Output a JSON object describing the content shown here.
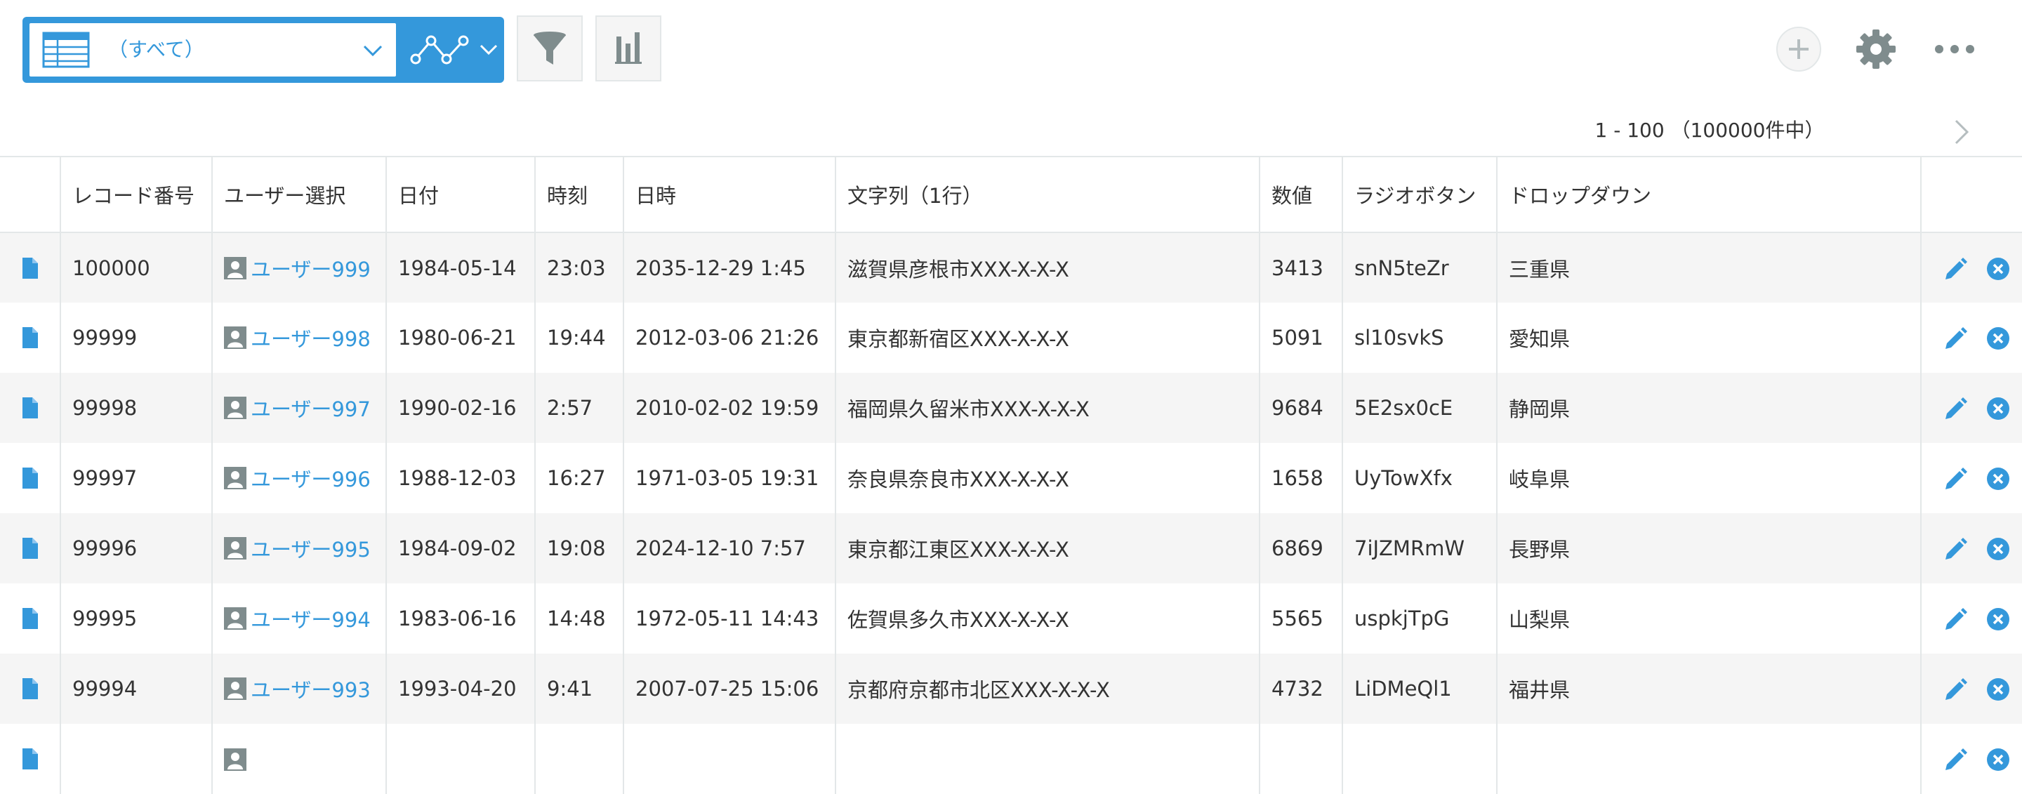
{
  "toolbar": {
    "view_label": "（すべて）",
    "icons": [
      "table-icon",
      "chevron-down-icon",
      "graph-icon",
      "filter-icon",
      "bar-chart-icon",
      "add-icon",
      "gear-icon",
      "more-icon"
    ]
  },
  "pager": {
    "range": "1 - 100 （100000件中）",
    "next_icon": "chevron-right-icon"
  },
  "table": {
    "headers": [
      "レコード番号",
      "ユーザー選択",
      "日付",
      "時刻",
      "日時",
      "文字列（1行）",
      "数値",
      "ラジオボタン",
      "ドロップダウン"
    ],
    "rows": [
      {
        "record_no": "100000",
        "user": "ユーザー999",
        "date": "1984-05-14",
        "time": "23:03",
        "datetime": "2035-12-29 1:45",
        "text": "滋賀県彦根市XXX-X-X-X",
        "number": "3413",
        "radio": "snN5teZr",
        "dropdown": "三重県"
      },
      {
        "record_no": "99999",
        "user": "ユーザー998",
        "date": "1980-06-21",
        "time": "19:44",
        "datetime": "2012-03-06 21:26",
        "text": "東京都新宿区XXX-X-X-X",
        "number": "5091",
        "radio": "sl10svkS",
        "dropdown": "愛知県"
      },
      {
        "record_no": "99998",
        "user": "ユーザー997",
        "date": "1990-02-16",
        "time": "2:57",
        "datetime": "2010-02-02 19:59",
        "text": "福岡県久留米市XXX-X-X-X",
        "number": "9684",
        "radio": "5E2sx0cE",
        "dropdown": "静岡県"
      },
      {
        "record_no": "99997",
        "user": "ユーザー996",
        "date": "1988-12-03",
        "time": "16:27",
        "datetime": "1971-03-05 19:31",
        "text": "奈良県奈良市XXX-X-X-X",
        "number": "1658",
        "radio": "UyTowXfx",
        "dropdown": "岐阜県"
      },
      {
        "record_no": "99996",
        "user": "ユーザー995",
        "date": "1984-09-02",
        "time": "19:08",
        "datetime": "2024-12-10 7:57",
        "text": "東京都江東区XXX-X-X-X",
        "number": "6869",
        "radio": "7iJZMRmW",
        "dropdown": "長野県"
      },
      {
        "record_no": "99995",
        "user": "ユーザー994",
        "date": "1983-06-16",
        "time": "14:48",
        "datetime": "1972-05-11 14:43",
        "text": "佐賀県多久市XXX-X-X-X",
        "number": "5565",
        "radio": "uspkjTpG",
        "dropdown": "山梨県"
      },
      {
        "record_no": "99994",
        "user": "ユーザー993",
        "date": "1993-04-20",
        "time": "9:41",
        "datetime": "2007-07-25 15:06",
        "text": "京都府京都市北区XXX-X-X-X",
        "number": "4732",
        "radio": "LiDMeQl1",
        "dropdown": "福井県"
      },
      {
        "record_no": "",
        "user": "",
        "date": "",
        "time": "",
        "datetime": "",
        "text": "",
        "number": "",
        "radio": "",
        "dropdown": ""
      }
    ]
  },
  "colors": {
    "accent": "#3498db",
    "row_alt": "#f5f5f5",
    "border": "#e3e7e8",
    "icon_gray": "#7f8c8d",
    "icon_light": "#b5bdbf"
  }
}
